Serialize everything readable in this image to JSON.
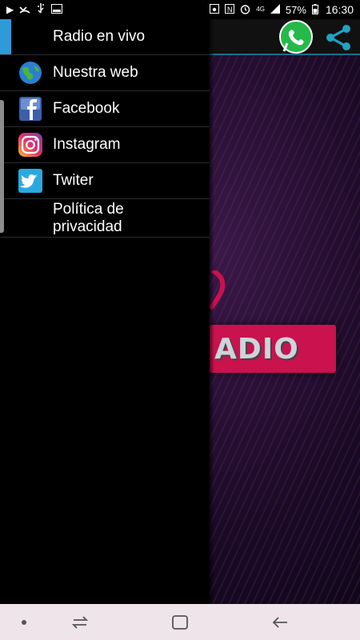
{
  "status_bar": {
    "battery": "57%",
    "time": "16:30",
    "icons": [
      "play-icon",
      "missed-call-icon",
      "usb-icon",
      "image-icon",
      "saved-icon",
      "nfc-icon",
      "alarm-icon",
      "4g-icon",
      "signal-icon",
      "battery-icon"
    ]
  },
  "app": {
    "logo_text": "ADIO",
    "whatsapp_icon": "whatsapp-icon",
    "share_icon": "share-icon",
    "accent_color": "#1d6f8a",
    "banner_color": "#c9124e"
  },
  "drawer": {
    "items": [
      {
        "label": "Radio en vivo",
        "icon": "none",
        "active": true
      },
      {
        "label": "Nuestra web",
        "icon": "globe-icon"
      },
      {
        "label": "Facebook",
        "icon": "facebook-icon"
      },
      {
        "label": "Instagram",
        "icon": "instagram-icon"
      },
      {
        "label": "Twiter",
        "icon": "twitter-icon"
      },
      {
        "label": "Política de\nprivacidad",
        "icon": "none"
      }
    ],
    "active_color": "#2f9ad8"
  },
  "nav_bar": {
    "buttons": [
      "dot-icon",
      "recents-icon",
      "home-icon",
      "back-icon"
    ]
  }
}
